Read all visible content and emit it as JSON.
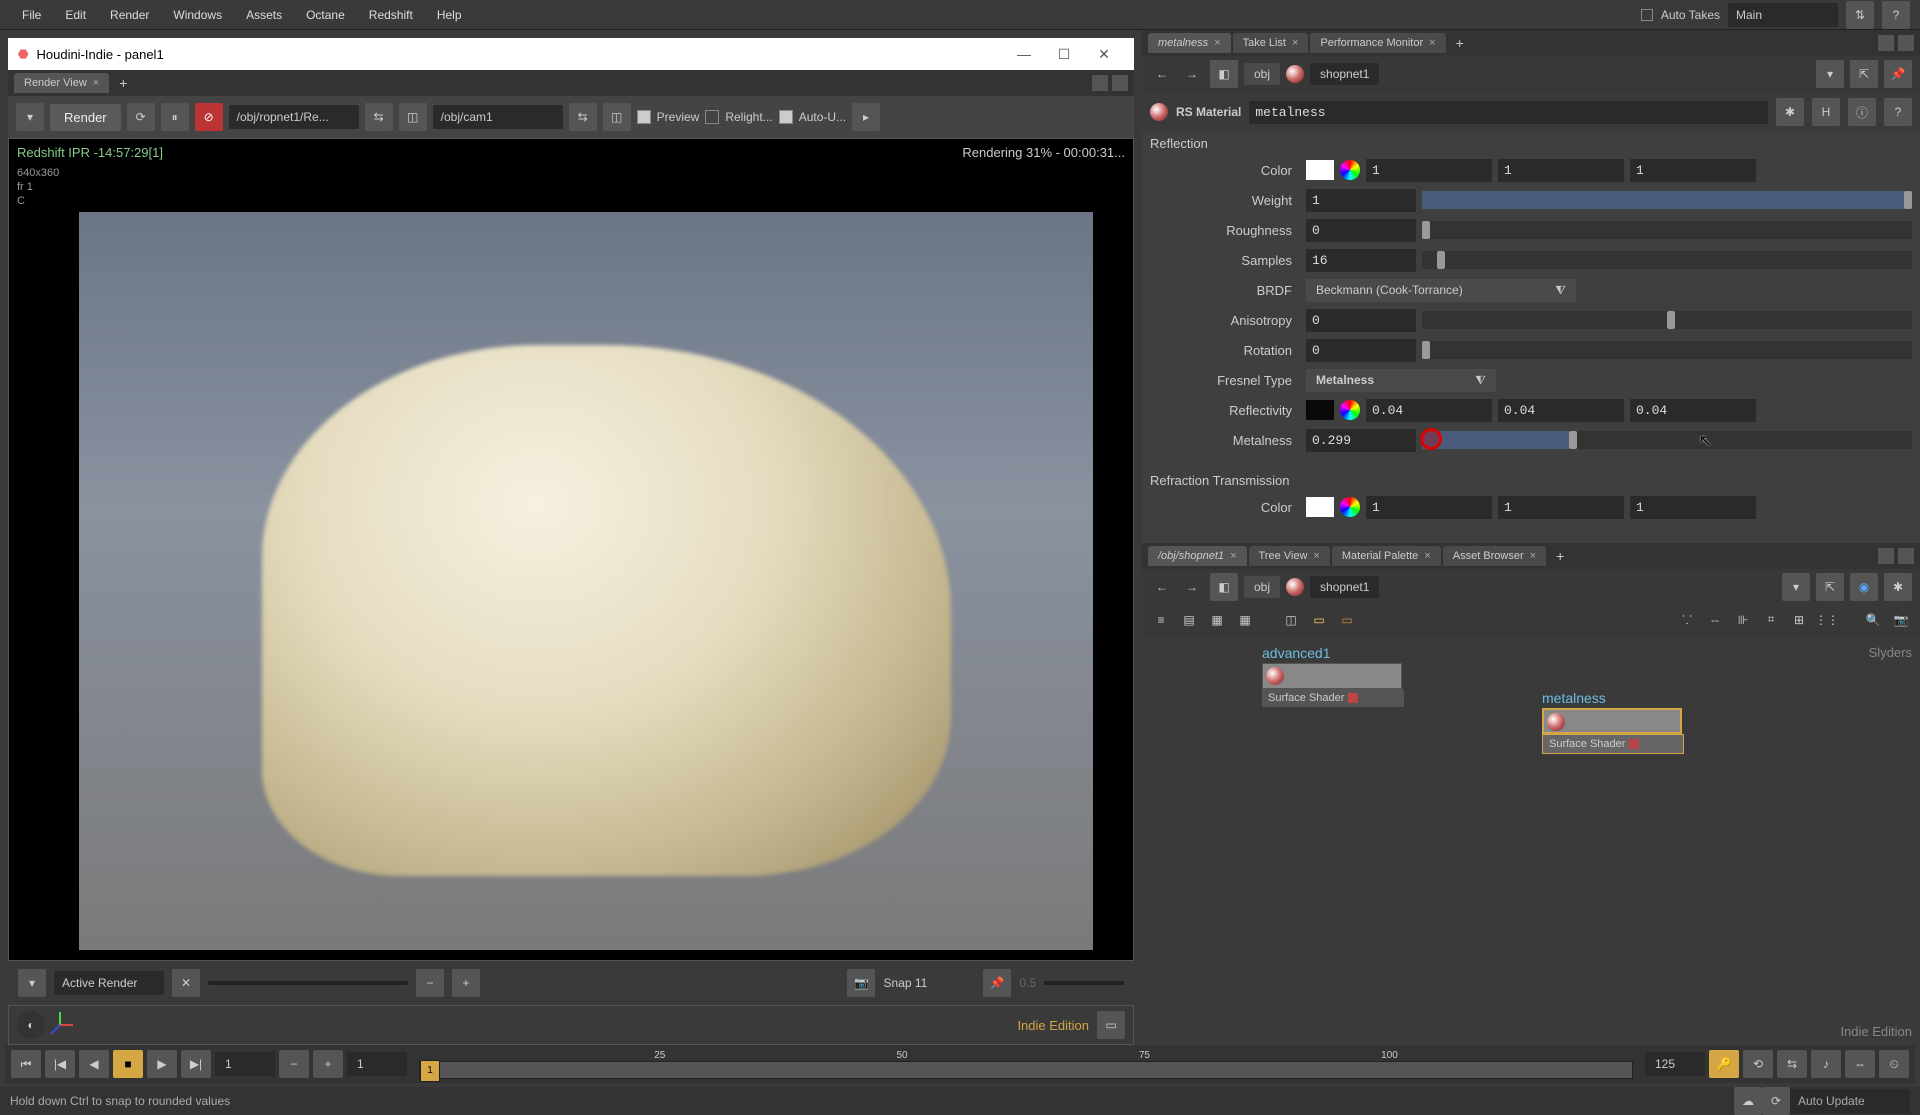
{
  "menu": {
    "items": [
      "File",
      "Edit",
      "Render",
      "Windows",
      "Assets",
      "Octane",
      "Redshift",
      "Help"
    ],
    "auto_takes": "Auto Takes",
    "take_dropdown": "Main"
  },
  "window": {
    "title": "Houdini-Indie - panel1"
  },
  "render_tabs": {
    "tab1": "Render View"
  },
  "render_toolbar": {
    "render": "Render",
    "rop_path": "/obj/ropnet1/Re...",
    "cam_path": "/obj/cam1",
    "preview": "Preview",
    "relight": "Relight...",
    "auto_update": "Auto-U..."
  },
  "viewport": {
    "title": "Redshift IPR -14:57:29[1]",
    "res": "640x360",
    "frame": "fr 1",
    "channel": "C",
    "status": "Rendering 31% - 00:00:31..."
  },
  "bottom": {
    "active_render": "Active Render",
    "snap": "Snap  11",
    "snap_opacity": "0.5"
  },
  "watermark": "Indie Edition",
  "timeline": {
    "ticks": [
      "25",
      "50",
      "75",
      "100"
    ],
    "start": "1",
    "end": "1",
    "end2": "125",
    "playhead": "1"
  },
  "status": "Hold down Ctrl to snap to rounded values",
  "params": {
    "tabs": {
      "metalness": "metalness",
      "takelist": "Take List",
      "perfmon": "Performance Monitor"
    },
    "breadcrumb": {
      "obj": "obj",
      "shopnet": "shopnet1"
    },
    "material": {
      "type": "RS Material",
      "name": "metalness"
    },
    "section_reflection": "Reflection",
    "section_refraction": "Refraction Transmission",
    "color_label": "Color",
    "color_r": "1",
    "color_g": "1",
    "color_b": "1",
    "weight_label": "Weight",
    "weight": "1",
    "roughness_label": "Roughness",
    "roughness": "0",
    "samples_label": "Samples",
    "samples": "16",
    "brdf_label": "BRDF",
    "brdf": "Beckmann (Cook-Torrance)",
    "aniso_label": "Anisotropy",
    "aniso": "0",
    "rotation_label": "Rotation",
    "rotation": "0",
    "fresnel_label": "Fresnel Type",
    "fresnel": "Metalness",
    "reflectivity_label": "Reflectivity",
    "refl_r": "0.04",
    "refl_g": "0.04",
    "refl_b": "0.04",
    "metalness_label": "Metalness",
    "metalness": "0.299",
    "refr_color_label": "Color",
    "refr_r": "1",
    "refr_g": "1",
    "refr_b": "1"
  },
  "network": {
    "tabs": {
      "shopnet": "/obj/shopnet1",
      "treeview": "Tree View",
      "matpal": "Material Palette",
      "assetbrowser": "Asset Browser"
    },
    "breadcrumb": {
      "obj": "obj",
      "shopnet": "shopnet1"
    },
    "node1": {
      "title": "advanced1",
      "footer": "Surface Shader"
    },
    "node2": {
      "title": "metalness",
      "footer": "Surface Shader"
    },
    "watermark": "Slyders",
    "indie": "Indie Edition"
  },
  "footer": {
    "auto_update": "Auto Update"
  }
}
